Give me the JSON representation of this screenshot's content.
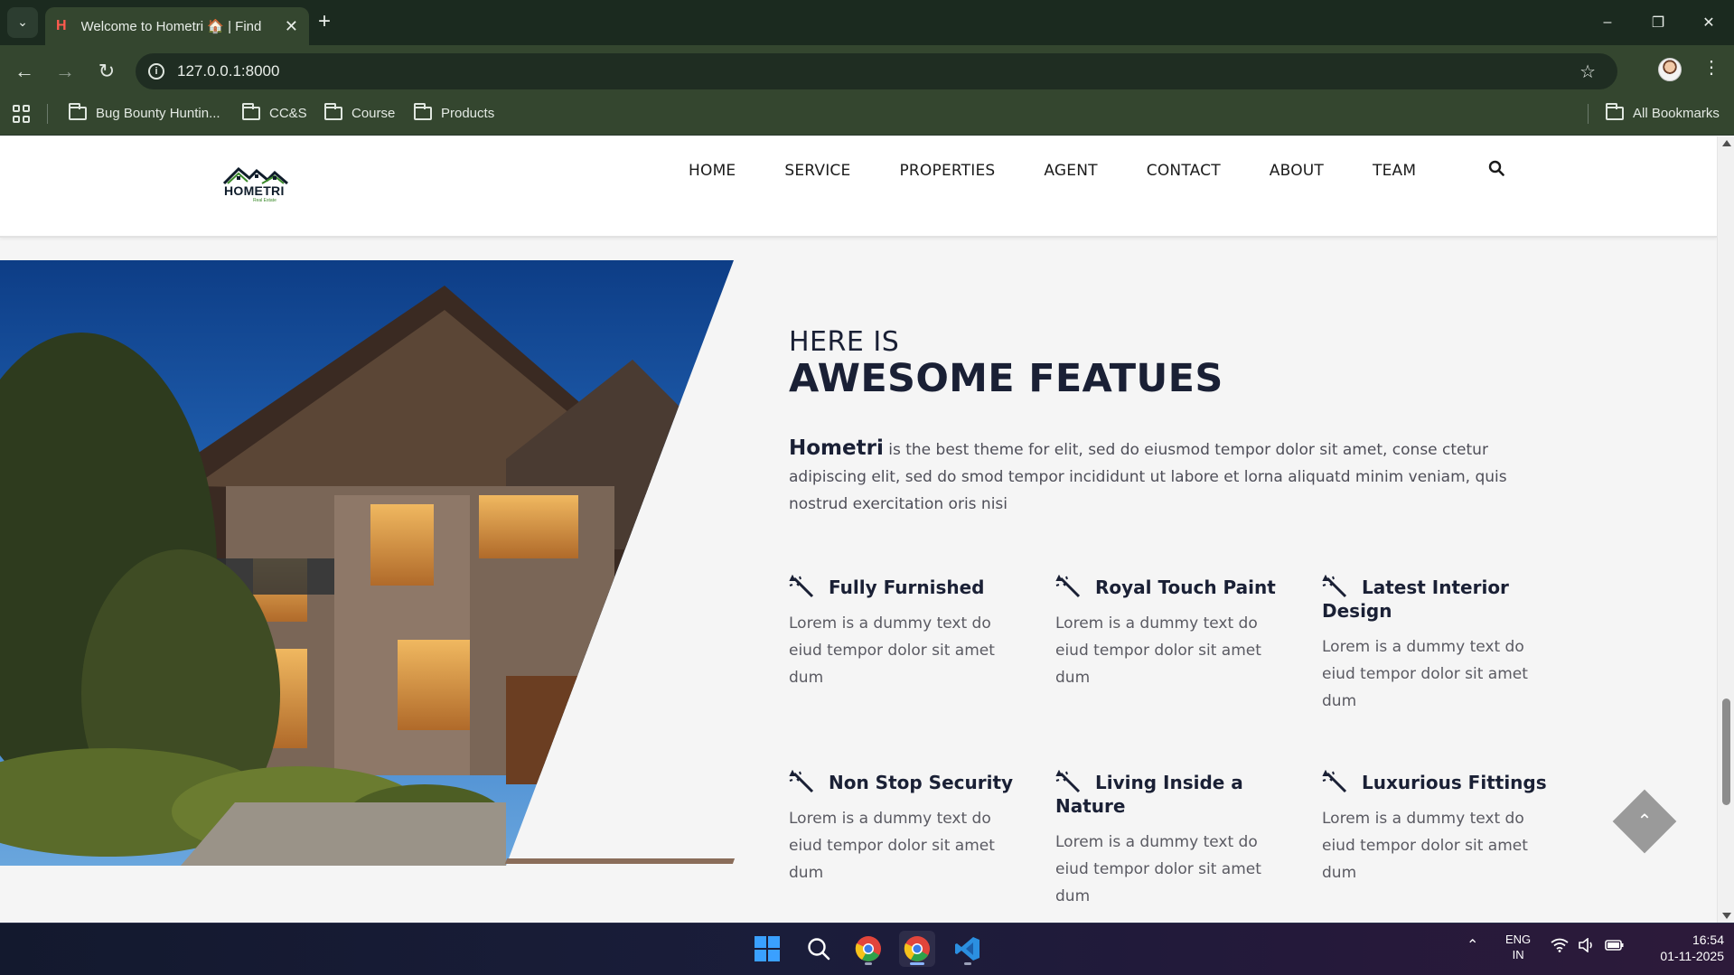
{
  "browser": {
    "tab_title": "Welcome to Hometri 🏠 | Find",
    "tab_close": "✕",
    "new_tab": "+",
    "url": "127.0.0.1:8000",
    "window_controls": {
      "minimize": "–",
      "restore": "❐",
      "close": "✕"
    },
    "bookmarks": [
      {
        "label": "Bug Bounty Huntin..."
      },
      {
        "label": "CC&S"
      },
      {
        "label": "Course"
      },
      {
        "label": "Products"
      }
    ],
    "all_bookmarks": "All Bookmarks"
  },
  "site": {
    "logo_text": "HOMETRI",
    "logo_sub": "Real Estate",
    "nav": [
      "HOME",
      "SERVICE",
      "PROPERTIES",
      "AGENT",
      "CONTACT",
      "ABOUT",
      "TEAM"
    ],
    "heading_small": "HERE IS",
    "heading_big": "AWESOME FEATUES",
    "intro_brand": "Hometri",
    "intro_text": " is the best theme for elit, sed do eiusmod tempor dolor sit amet, conse ctetur adipiscing elit, sed do smod tempor incididunt ut labore et lorna aliquatd minim veniam, quis nostrud exercitation oris nisi",
    "features": [
      {
        "title": "Fully Furnished",
        "text": "Lorem is a dummy text do eiud tempor dolor sit amet dum"
      },
      {
        "title": "Royal Touch Paint",
        "text": "Lorem is a dummy text do eiud tempor dolor sit amet dum"
      },
      {
        "title": "Latest Interior Design",
        "text": "Lorem is a dummy text do eiud tempor dolor sit amet dum"
      },
      {
        "title": "Non Stop Security",
        "text": "Lorem is a dummy text do eiud tempor dolor sit amet dum"
      },
      {
        "title": "Living Inside a Nature",
        "text": "Lorem is a dummy text do eiud tempor dolor sit amet dum"
      },
      {
        "title": "Luxurious Fittings",
        "text": "Lorem is a dummy text do eiud tempor dolor sit amet dum"
      }
    ],
    "feature_icon": "magic-wand-icon"
  },
  "taskbar": {
    "apps": [
      "windows-start-icon",
      "search-icon",
      "chrome-icon",
      "chrome-profile-icon",
      "vscode-icon"
    ],
    "lang_line1": "ENG",
    "lang_line2": "IN",
    "time": "16:54",
    "date": "01-11-2025"
  },
  "colors": {
    "browser_frame": "#1b2a1f",
    "browser_toolbar": "#34462f",
    "heading": "#1a2035",
    "body_text": "#5a5a62",
    "page_bg": "#f5f5f5"
  }
}
